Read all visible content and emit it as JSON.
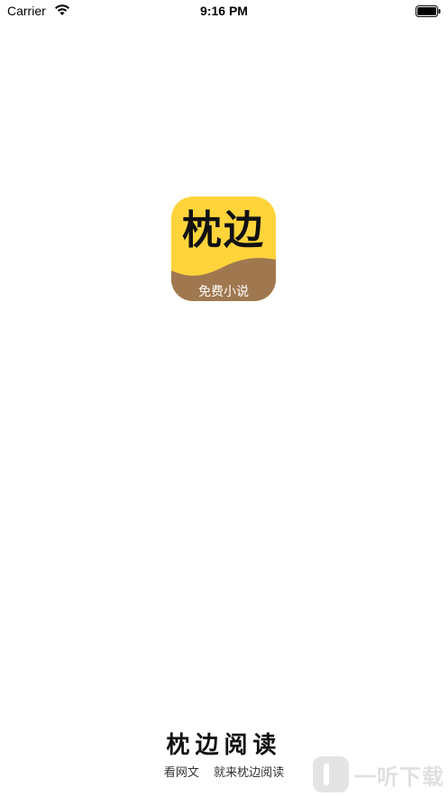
{
  "status_bar": {
    "carrier": "Carrier",
    "time": "9:16 PM",
    "wifi_icon": "wifi-icon",
    "battery_icon": "battery-icon"
  },
  "app_icon": {
    "title": "枕边",
    "subtitle": "免费小说",
    "colors": {
      "background": "#ffd43b",
      "wave": "#a07850"
    }
  },
  "footer": {
    "brand_name": "枕边阅读",
    "slogan_left": "看网文",
    "slogan_right": "就来枕边阅读"
  },
  "watermark": {
    "text": "一听下载"
  }
}
